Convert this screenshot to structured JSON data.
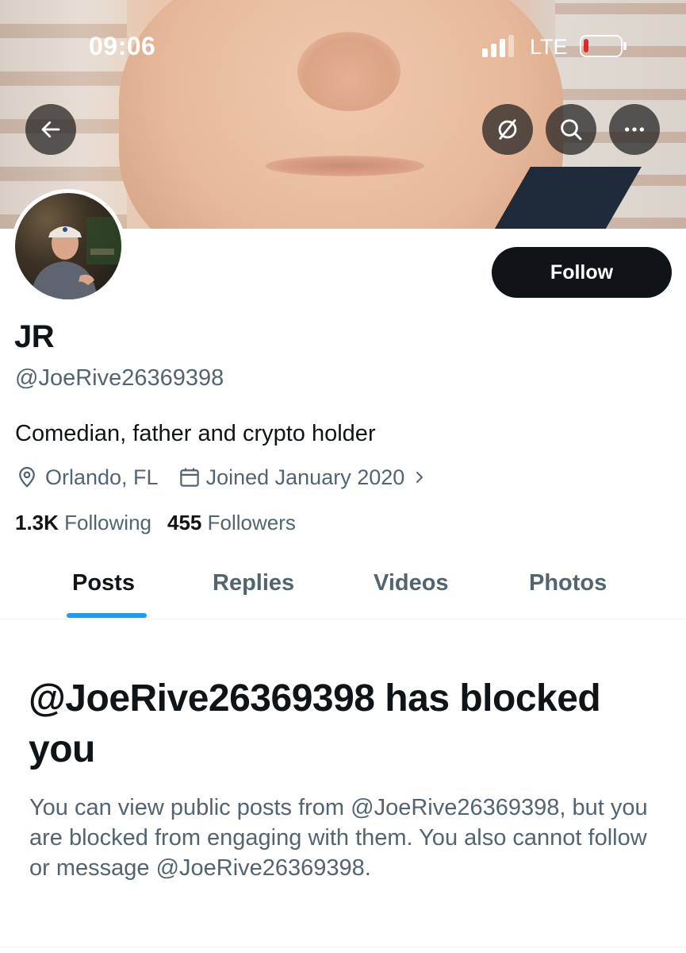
{
  "status_bar": {
    "time": "09:06",
    "network": "LTE",
    "battery_level": 0.1
  },
  "header": {
    "back_icon": "arrow-left-icon",
    "grok_icon": "slash-circle-icon",
    "search_icon": "search-icon",
    "more_icon": "more-dots-icon"
  },
  "profile": {
    "display_name": "JR",
    "handle": "@JoeRive26369398",
    "bio": "Comedian, father and crypto holder",
    "location": "Orlando, FL",
    "joined": "Joined January 2020",
    "following_count": "1.3K",
    "following_label": "Following",
    "followers_count": "455",
    "followers_label": "Followers",
    "follow_button": "Follow"
  },
  "tabs": {
    "items": [
      {
        "label": "Posts",
        "active": true
      },
      {
        "label": "Replies",
        "active": false
      },
      {
        "label": "Videos",
        "active": false
      },
      {
        "label": "Photos",
        "active": false
      }
    ]
  },
  "blocked": {
    "title": "@JoeRive26369398 has blocked you",
    "description": "You can view public posts from @JoeRive26369398, but you are blocked from engaging with them. You also cannot follow or message @JoeRive26369398."
  },
  "colors": {
    "accent": "#1d9bf0",
    "text_primary": "#0f1419",
    "text_secondary": "#536471",
    "battery_low": "#e0282a"
  }
}
